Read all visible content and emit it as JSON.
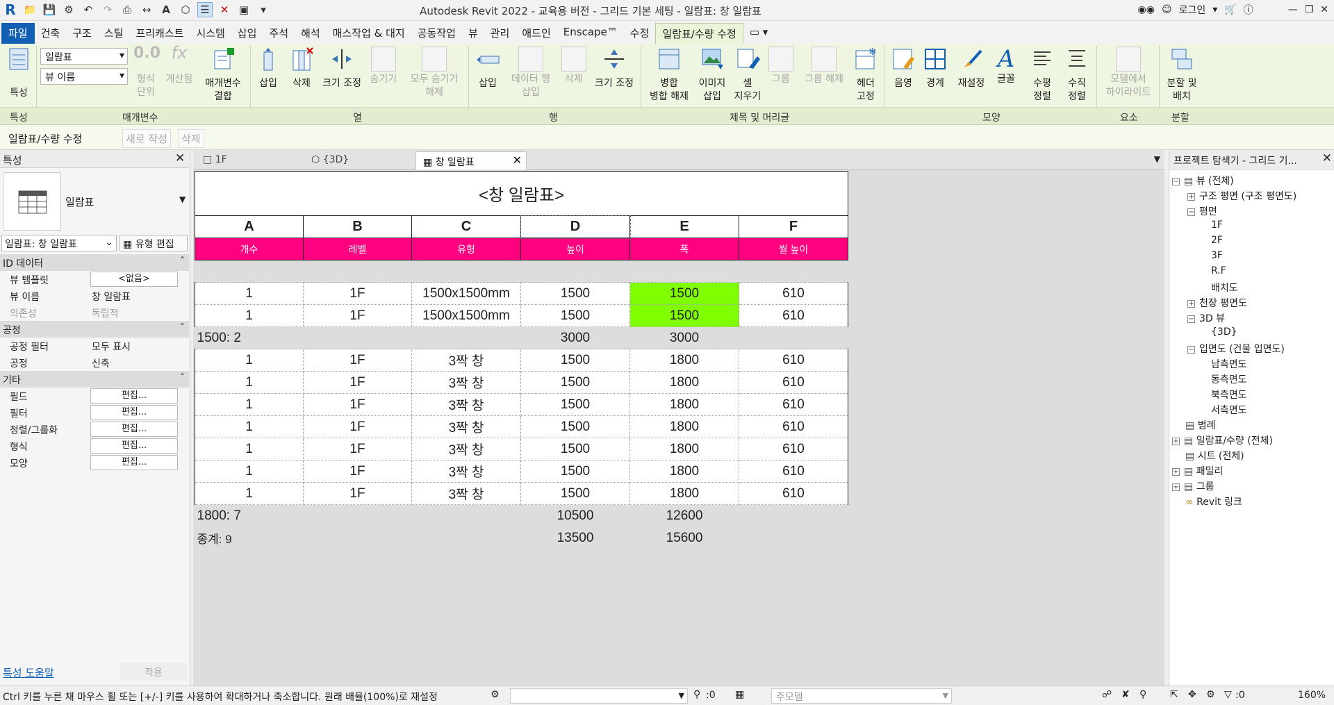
{
  "titlebar": {
    "title": "Autodesk Revit 2022 - 교육용 버전 - 그리드 기본 세팅 - 일람표: 창 일람표",
    "login": "로그인"
  },
  "tabs": [
    "파일",
    "건축",
    "구조",
    "스틸",
    "프리캐스트",
    "시스템",
    "삽입",
    "주석",
    "해석",
    "매스작업 & 대지",
    "공동작업",
    "뷰",
    "관리",
    "애드인",
    "Enscape™",
    "수정",
    "일람표/수량 수정"
  ],
  "ribbon": {
    "properties": "특성",
    "dropdown1": "일람표",
    "dropdown2": "뷰 이름",
    "format_unit": "형식\n단위",
    "calculated": "계산됨",
    "combine_params": "매개변수\n결합",
    "insert": "삽입",
    "delete": "삭제",
    "resize": "크기 조정",
    "hide": "숨기기",
    "unhide_all": "모두 숨기기\n해제",
    "row_insert": "삽입",
    "insert_data_row": "데이터 행\n삽입",
    "row_delete": "삭제",
    "row_resize": "크기 조정",
    "merge_unmerge": "병합\n병합 해제",
    "insert_image": "이미지\n삽입",
    "clear_cell": "셀\n지우기",
    "group": "그룹",
    "ungroup": "그룹 해제",
    "freeze_header": "헤더\n고정",
    "shading": "음영",
    "borders": "경계",
    "reset": "재설정",
    "font": "글꼴",
    "align_h": "수평\n정렬",
    "align_v": "수직\n정렬",
    "highlight_model": "모델에서\n하이라이트",
    "split_place": "분할 및\n배치",
    "panels": [
      "특성",
      "매개변수",
      "열",
      "행",
      "제목 및 머리글",
      "모양",
      "요소",
      "분할"
    ]
  },
  "context_bar": {
    "label": "일람표/수량 수정",
    "new": "새로 작성",
    "delete": "삭제"
  },
  "properties_panel": {
    "title": "특성",
    "type_name": "일람표",
    "selector": "일람표: 창 일람표",
    "edit_type": "유형 편집",
    "sections": [
      {
        "name": "ID 데이터",
        "rows": [
          {
            "key": "뷰 템플릿",
            "value": "<없음>",
            "cell": true
          },
          {
            "key": "뷰 이름",
            "value": "창 일람표"
          },
          {
            "key": "의존성",
            "value": "독립적"
          }
        ]
      },
      {
        "name": "공정",
        "rows": [
          {
            "key": "공정 필터",
            "value": "모두 표시"
          },
          {
            "key": "공정",
            "value": "신축"
          }
        ]
      },
      {
        "name": "기타",
        "rows": [
          {
            "key": "필드",
            "value": "편집...",
            "cell": true
          },
          {
            "key": "필터",
            "value": "편집...",
            "cell": true
          },
          {
            "key": "정렬/그룹화",
            "value": "편집...",
            "cell": true
          },
          {
            "key": "형식",
            "value": "편집...",
            "cell": true
          },
          {
            "key": "모양",
            "value": "편집...",
            "cell": true
          }
        ]
      }
    ],
    "help_link": "특성 도움말",
    "apply": "적용"
  },
  "doc_tabs": [
    {
      "label": "1F",
      "icon": "floor-plan-icon"
    },
    {
      "label": "{3D}",
      "icon": "3d-view-icon"
    },
    {
      "label": "창 일람표",
      "icon": "schedule-icon",
      "active": true
    }
  ],
  "schedule": {
    "title": "<창 일람표>",
    "letters": [
      "A",
      "B",
      "C",
      "D",
      "E",
      "F"
    ],
    "headers": [
      "개수",
      "레벨",
      "유형",
      "높이",
      "폭",
      "씰 높이"
    ],
    "group1": [
      [
        "1",
        "1F",
        "1500x1500mm",
        "1500",
        "1500",
        "610"
      ],
      [
        "1",
        "1F",
        "1500x1500mm",
        "1500",
        "1500",
        "610"
      ]
    ],
    "subtotal1": {
      "label": "1500: 2",
      "d": "3000",
      "e": "3000"
    },
    "group2": [
      [
        "1",
        "1F",
        "3짝 창",
        "1500",
        "1800",
        "610"
      ],
      [
        "1",
        "1F",
        "3짝 창",
        "1500",
        "1800",
        "610"
      ],
      [
        "1",
        "1F",
        "3짝 창",
        "1500",
        "1800",
        "610"
      ],
      [
        "1",
        "1F",
        "3짝 창",
        "1500",
        "1800",
        "610"
      ],
      [
        "1",
        "1F",
        "3짝 창",
        "1500",
        "1800",
        "610"
      ],
      [
        "1",
        "1F",
        "3짝 창",
        "1500",
        "1800",
        "610"
      ],
      [
        "1",
        "1F",
        "3짝 창",
        "1500",
        "1800",
        "610"
      ]
    ],
    "subtotal2": {
      "label": "1800: 7",
      "d": "10500",
      "e": "12600"
    },
    "grand_total": {
      "label": "종계: 9",
      "d": "13500",
      "e": "15600"
    },
    "highlight_color": "#80ff00",
    "header_color": "#ff0080"
  },
  "project_browser": {
    "title": "프로젝트 탐색기 - 그리드 기...",
    "tree": [
      {
        "label": "뷰 (전체)",
        "level": 0,
        "expander": "-",
        "icon": "views-icon"
      },
      {
        "label": "구조 평면 (구조 평면도)",
        "level": 1,
        "expander": "+"
      },
      {
        "label": "평면",
        "level": 1,
        "expander": "-"
      },
      {
        "label": "1F",
        "level": 2
      },
      {
        "label": "2F",
        "level": 2
      },
      {
        "label": "3F",
        "level": 2
      },
      {
        "label": "R.F",
        "level": 2
      },
      {
        "label": "배치도",
        "level": 2
      },
      {
        "label": "천장 평면도",
        "level": 1,
        "expander": "+"
      },
      {
        "label": "3D 뷰",
        "level": 1,
        "expander": "-"
      },
      {
        "label": "{3D}",
        "level": 2
      },
      {
        "label": "입면도 (건물 입면도)",
        "level": 1,
        "expander": "-"
      },
      {
        "label": "남측면도",
        "level": 2
      },
      {
        "label": "동측면도",
        "level": 2
      },
      {
        "label": "북측면도",
        "level": 2
      },
      {
        "label": "서측면도",
        "level": 2
      },
      {
        "label": "범례",
        "level": 0,
        "icon": "legend-icon"
      },
      {
        "label": "일람표/수량 (전체)",
        "level": 0,
        "expander": "+",
        "icon": "schedule-icon"
      },
      {
        "label": "시트 (전체)",
        "level": 0,
        "icon": "sheet-icon"
      },
      {
        "label": "패밀리",
        "level": 0,
        "expander": "+",
        "icon": "family-icon"
      },
      {
        "label": "그룹",
        "level": 0,
        "expander": "+",
        "icon": "group-icon"
      },
      {
        "label": "Revit 링크",
        "level": 0,
        "icon": "link-icon"
      }
    ]
  },
  "status_bar": {
    "message": "Ctrl 키를 누른 채 마우스 휠 또는 [+/-] 키를 사용하여 확대하거나 축소합니다. 원래 배율(100%)로 재설정",
    "zero": ":0",
    "main_model": "주모델",
    "filter_count": ":0",
    "zoom": "160%"
  }
}
